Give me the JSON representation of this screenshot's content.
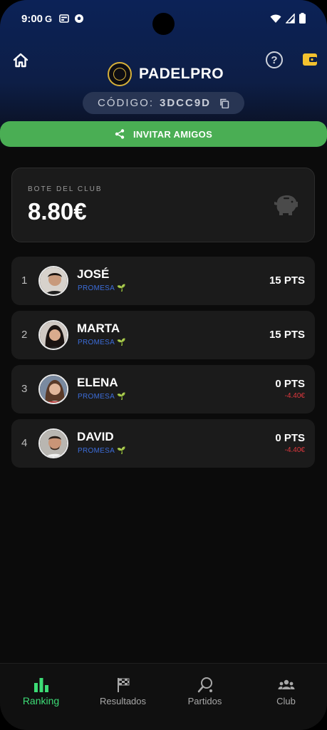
{
  "status_bar": {
    "time": "9:00"
  },
  "app": {
    "name": "PADELPRO"
  },
  "code": {
    "label": "CÓDIGO:",
    "value": "3DCC9D"
  },
  "invite": {
    "label": "INVITAR AMIGOS"
  },
  "pot": {
    "label": "BOTE DEL CLUB",
    "value": "8.80€"
  },
  "ranking": [
    {
      "position": "1",
      "name": "JOSÉ",
      "tier": "PROMESA",
      "points": "15 PTS",
      "debt": ""
    },
    {
      "position": "2",
      "name": "MARTA",
      "tier": "PROMESA",
      "points": "15 PTS",
      "debt": ""
    },
    {
      "position": "3",
      "name": "ELENA",
      "tier": "PROMESA",
      "points": "0 PTS",
      "debt": "-4.40€"
    },
    {
      "position": "4",
      "name": "DAVID",
      "tier": "PROMESA",
      "points": "0 PTS",
      "debt": "-4.40€"
    }
  ],
  "nav": {
    "ranking": "Ranking",
    "resultados": "Resultados",
    "partidos": "Partidos",
    "club": "Club"
  },
  "colors": {
    "accent_green": "#4aae54",
    "active_tab": "#3ddc76",
    "tier_blue": "#3c6dda",
    "debt_red": "#e0383e",
    "wallet_yellow": "#f2c12e"
  }
}
